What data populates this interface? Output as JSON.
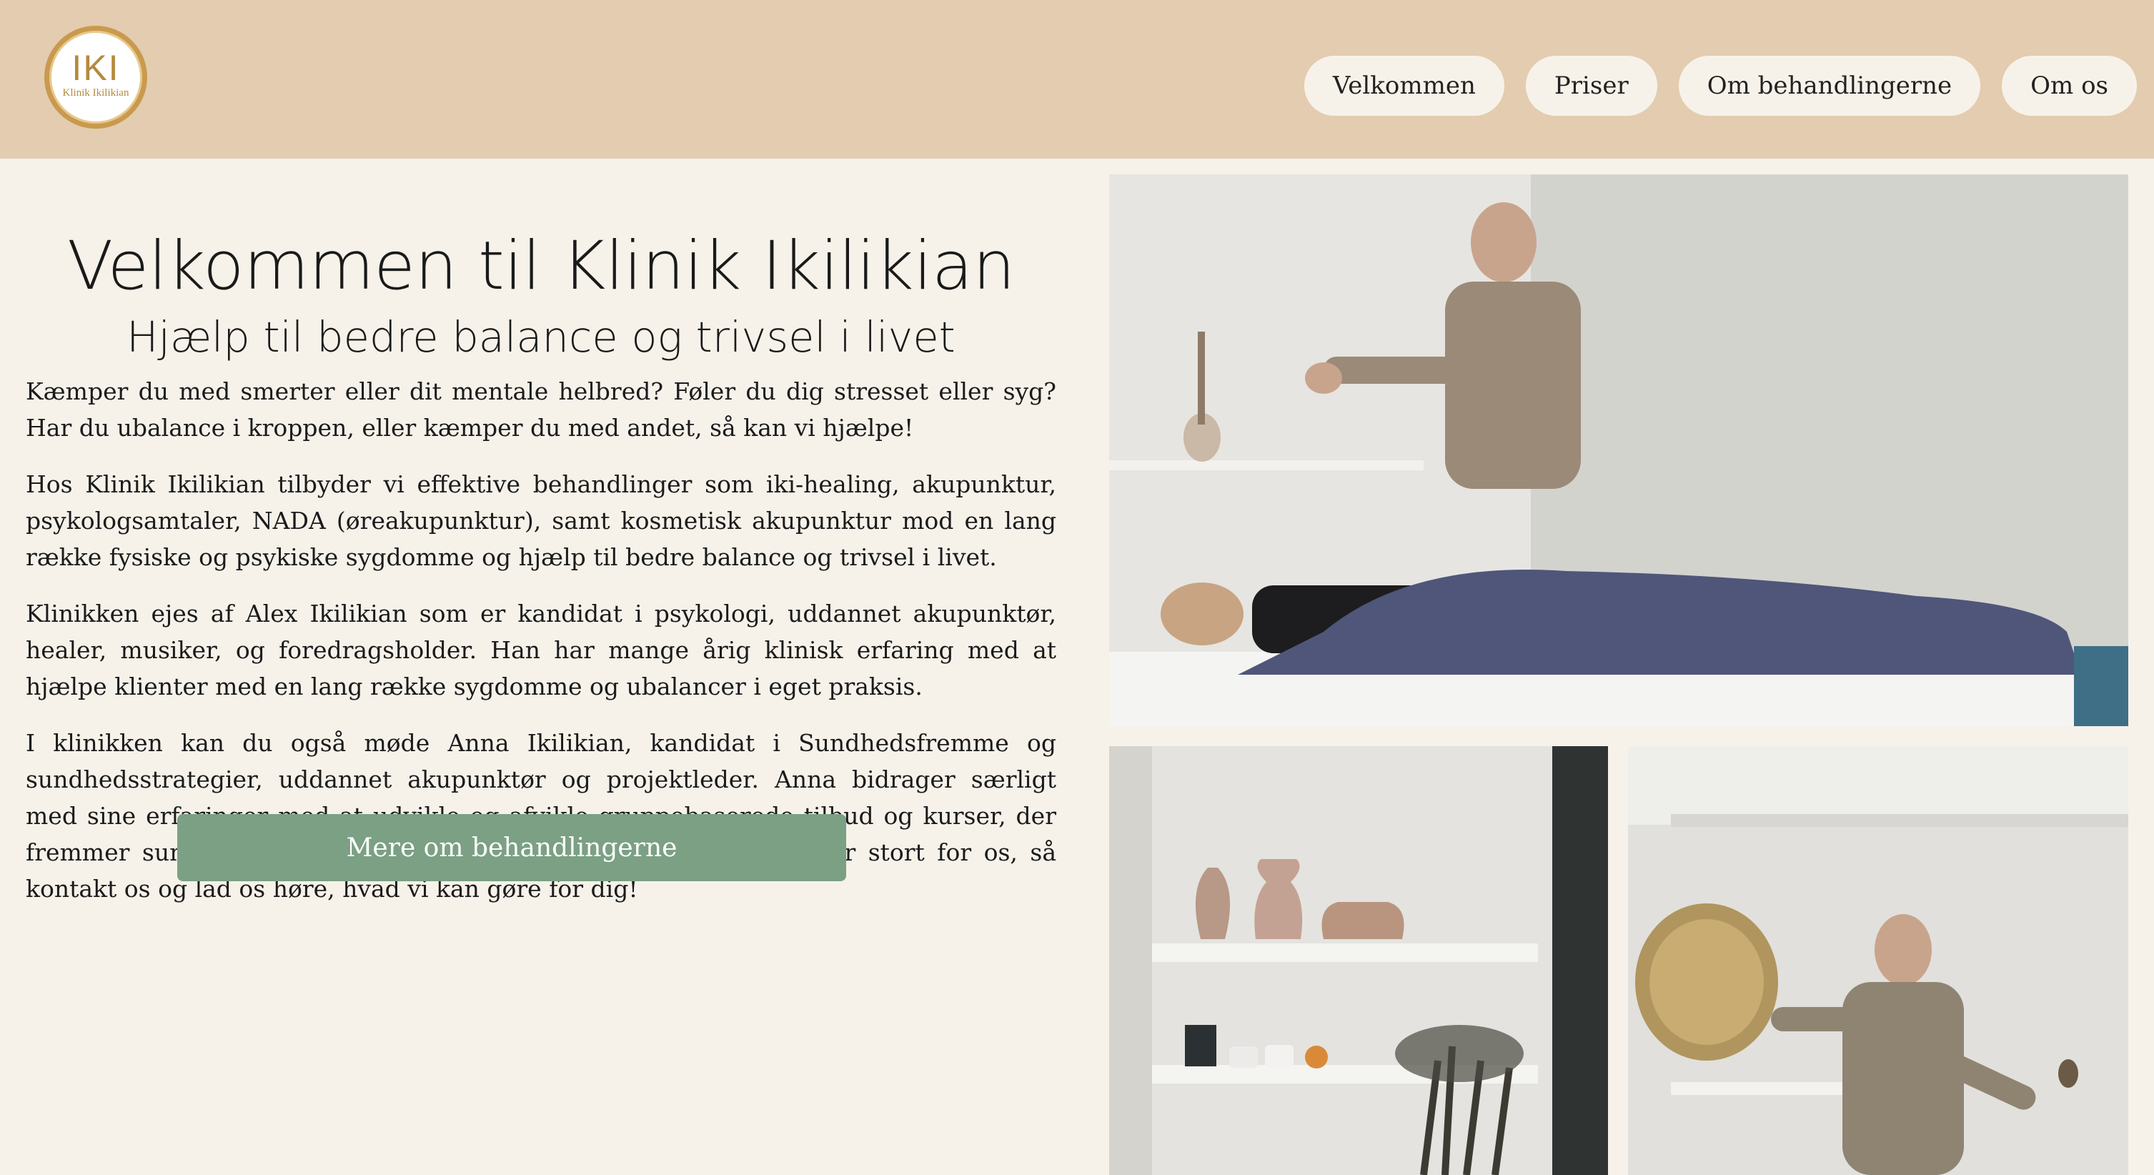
{
  "header": {
    "logo": {
      "mark": "IKI",
      "text": "Klinik Ikilikian",
      "icon": "clinic-logo"
    },
    "nav": [
      {
        "label": "Velkommen"
      },
      {
        "label": "Priser"
      },
      {
        "label": "Om behandlingerne"
      },
      {
        "label": "Om os"
      }
    ]
  },
  "main": {
    "title": "Velkommen til Klinik Ikilikian",
    "subtitle": "Hjælp til bedre balance og trivsel i livet",
    "paragraphs": [
      "Kæmper du med smerter eller dit mentale helbred? Føler du dig stresset eller syg? Har du ubalance i kroppen, eller kæmper du med andet, så kan vi hjælpe!",
      "Hos Klinik Ikilikian tilbyder vi effektive behandlinger som iki-healing, akupunktur, psykologsamtaler, NADA (øreakupunktur), samt kosmetisk akupunktur mod en lang række fysiske og psykiske sygdomme og hjælp til bedre balance og trivsel i livet.",
      "Klinikken ejes af Alex Ikilikian som er kandidat i psykologi, uddannet akupunktør, healer, musiker, og foredragsholder. Han har mange årig klinisk erfaring med at hjælpe klienter med en lang række sygdomme og ubalancer i eget praksis.",
      "I klinikken kan du også møde Anna Ikilikian, kandidat i Sundhedsfremme og sundhedsstrategier, uddannet akupunktør og projektleder. Anna bidrager særligt med sine erfaringer med at udvikle og afvikle gruppebaserede tilbud og kurser, der fremmer sundhed, trivsel og det gode liv. Der er intet, der er for stort for os, så kontakt os og lad os høre, hvad vi kan gøre for dig!"
    ],
    "cta_label": "Mere om behandlingerne"
  },
  "colors": {
    "header_bg": "#e3ccb0",
    "page_bg": "#f6f2ea",
    "nav_pill_bg": "#f7f2e9",
    "cta_bg": "#7ba084",
    "logo_gold": "#c99a4e"
  }
}
